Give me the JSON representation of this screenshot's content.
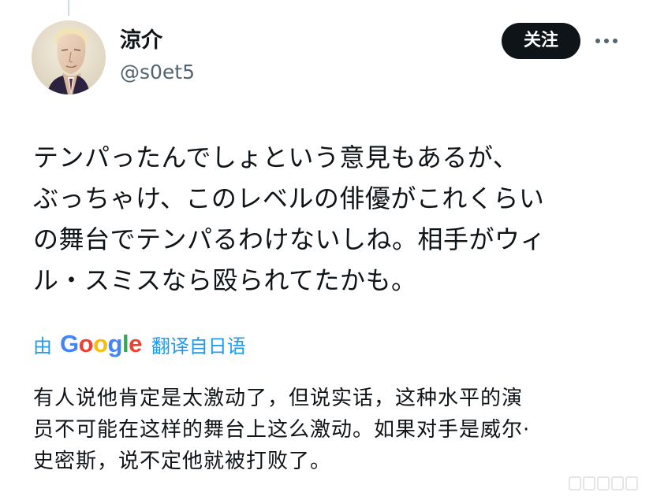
{
  "author": {
    "display_name": "涼介",
    "handle": "@s0et5"
  },
  "actions": {
    "follow_label": "关注",
    "more_icon": "more-horizontal-icon"
  },
  "tweet": {
    "text_lines": [
      "テンパったんでしょという意見もあるが、",
      "ぶっちゃけ、このレベルの俳優がこれくらい",
      "の舞台でテンパるわけないしね。相手がウィ",
      "ル・スミスなら殴られてたかも。"
    ]
  },
  "translation": {
    "by_label": "由",
    "google_logo_text": "Google",
    "google_colors": [
      "#4285F4",
      "#EA4335",
      "#FBBC05",
      "#4285F4",
      "#34A853",
      "#EA4335"
    ],
    "action_label": "翻译自日语",
    "link_color": "#1d9bf0",
    "text_lines": [
      "有人说他肯定是太激动了，但说实话，这种水平的演",
      "员不可能在这样的舞台上这么激动。如果对手是威尔·",
      "史密斯，说不定他就被打败了。"
    ]
  },
  "colors": {
    "text_primary": "#0f1419",
    "text_secondary": "#536471",
    "follow_bg": "#0f1419"
  }
}
